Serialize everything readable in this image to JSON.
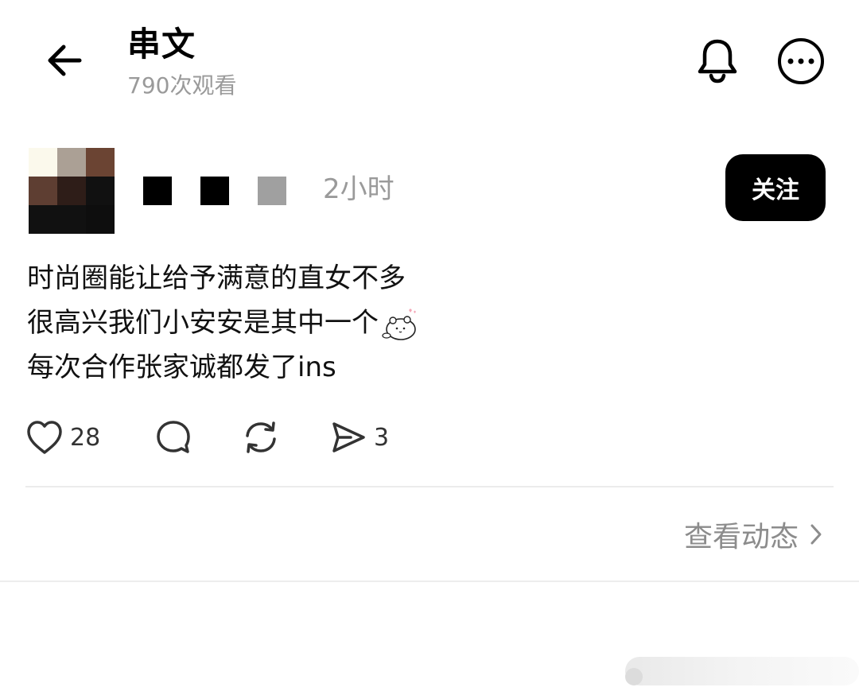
{
  "header": {
    "title": "串文",
    "views": "790次观看",
    "icons": {
      "back": "back-arrow-icon",
      "bell": "bell-icon",
      "more": "more-options-icon"
    }
  },
  "author": {
    "time": "2小时",
    "follow_label": "关注",
    "avatar_colors": [
      "#fbf9ec",
      "#aba095",
      "#6b4433",
      "#5e3e32",
      "#2e1d18",
      "#111111",
      "#111111",
      "#111111",
      "#0e0e0e"
    ]
  },
  "post": {
    "lines": [
      "时尚圈能让给予满意的直女不多",
      "很高兴我们小安安是其中一个",
      "每次合作张家诚都发了ins"
    ]
  },
  "actions": {
    "like_count": "28",
    "share_count": "3",
    "icons": [
      "heart-icon",
      "comment-icon",
      "repost-icon",
      "share-icon"
    ]
  },
  "footer": {
    "view_dynamic_label": "查看动态"
  }
}
